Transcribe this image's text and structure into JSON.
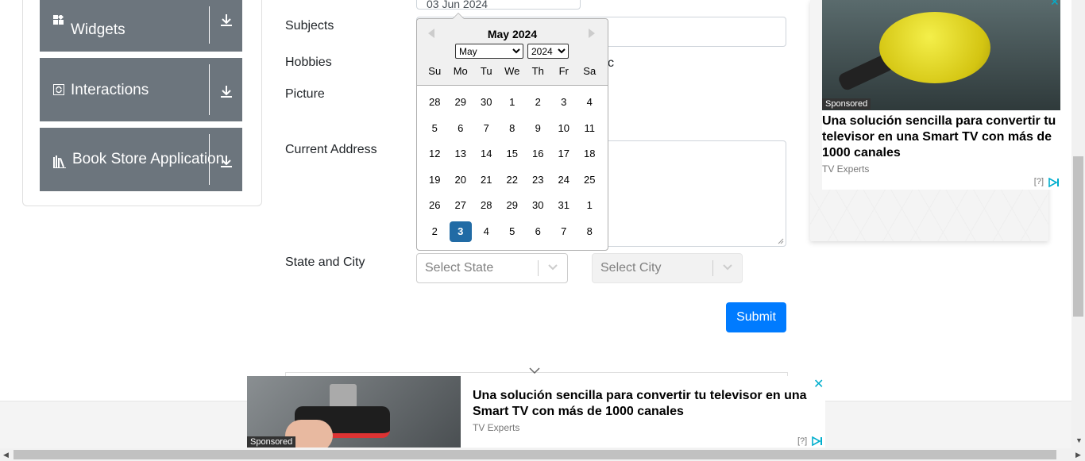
{
  "sidebar": {
    "groups": [
      {
        "title": "Widgets",
        "icon": "widgets-icon"
      },
      {
        "title": "Interactions",
        "icon": "interactions-icon"
      },
      {
        "title": "Book Store Application",
        "icon": "book-store-icon"
      }
    ]
  },
  "form": {
    "date_value": "03 Jun 2024",
    "subjects_label": "Subjects",
    "hobbies_label": "Hobbies",
    "hobbies_partial_text": "c",
    "picture_label": "Picture",
    "address_label": "Current Address",
    "state_city_label": "State and City",
    "state_placeholder": "Select State",
    "city_placeholder": "Select City",
    "submit_label": "Submit"
  },
  "datepicker": {
    "header": "May 2024",
    "month_select": "May",
    "year_select": "2024",
    "weekdays": [
      "Su",
      "Mo",
      "Tu",
      "We",
      "Th",
      "Fr",
      "Sa"
    ],
    "weeks": [
      [
        "28",
        "29",
        "30",
        "1",
        "2",
        "3",
        "4"
      ],
      [
        "5",
        "6",
        "7",
        "8",
        "9",
        "10",
        "11"
      ],
      [
        "12",
        "13",
        "14",
        "15",
        "16",
        "17",
        "18"
      ],
      [
        "19",
        "20",
        "21",
        "22",
        "23",
        "24",
        "25"
      ],
      [
        "26",
        "27",
        "28",
        "29",
        "30",
        "31",
        "1"
      ],
      [
        "2",
        "3",
        "4",
        "5",
        "6",
        "7",
        "8"
      ]
    ],
    "selected_day": "3"
  },
  "ad_right": {
    "sponsored": "Sponsored",
    "title": "Una solución sencilla para convertir tu televisor en una Smart TV con más de 1000 canales",
    "source": "TV Experts",
    "adchoices": "[?]"
  },
  "ad_bottom": {
    "sponsored": "Sponsored",
    "title": "Una solución sencilla para convertir tu televisor en una Smart TV con más de 1000 canales",
    "source": "TV Experts",
    "adchoices": "[?]",
    "close": "✕"
  },
  "colors": {
    "sidebar_header": "#6c757d",
    "submit": "#007bff",
    "selected_day": "#216ba5"
  }
}
